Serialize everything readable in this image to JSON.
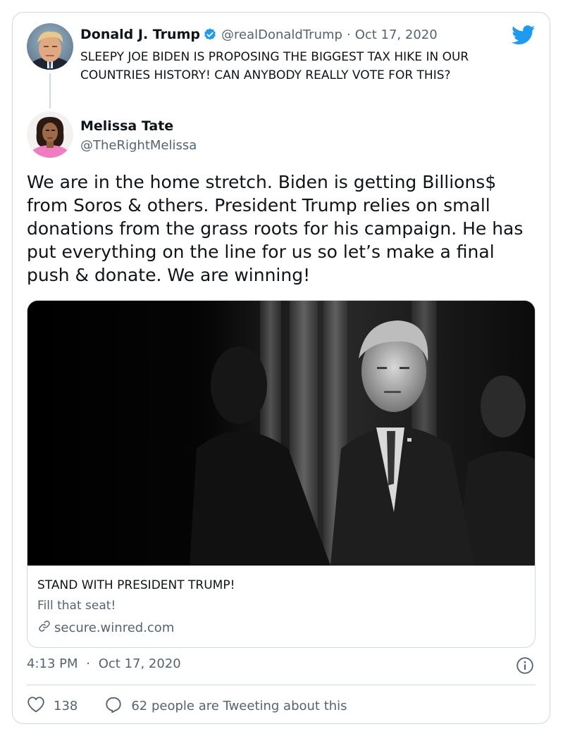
{
  "quoted_tweet": {
    "name": "Donald J. Trump",
    "handle": "@realDonaldTrump",
    "separator": "·",
    "date": "Oct 17, 2020",
    "text": "SLEEPY JOE BIDEN IS PROPOSING THE BIGGEST TAX HIKE IN OUR COUNTRIES HISTORY! CAN ANYBODY REALLY VOTE FOR THIS?"
  },
  "tweet": {
    "name": "Melissa Tate",
    "handle": "@TheRightMelissa",
    "text": "We are in the home stretch. Biden is getting Billions$ from Soros & others. President Trump relies on small donations from the grass roots for his campaign. He has put everything on the line for us so let’s make a final push & donate. We are winning!"
  },
  "link_card": {
    "title": "STAND WITH PRESIDENT TRUMP!",
    "description": "Fill that seat!",
    "domain": "secure.winred.com"
  },
  "footer": {
    "time": "4:13 PM",
    "separator": "·",
    "date": "Oct 17, 2020",
    "like_count": "138",
    "reply_text": "62 people are Tweeting about this"
  },
  "colors": {
    "brand_blue": "#1d9bf0",
    "text_primary": "#0f1419",
    "text_secondary": "#536471",
    "border": "#cfd9de"
  },
  "icons": [
    "verified-badge-icon",
    "twitter-bird-icon",
    "link-icon",
    "info-icon",
    "heart-icon",
    "reply-bubble-icon"
  ]
}
